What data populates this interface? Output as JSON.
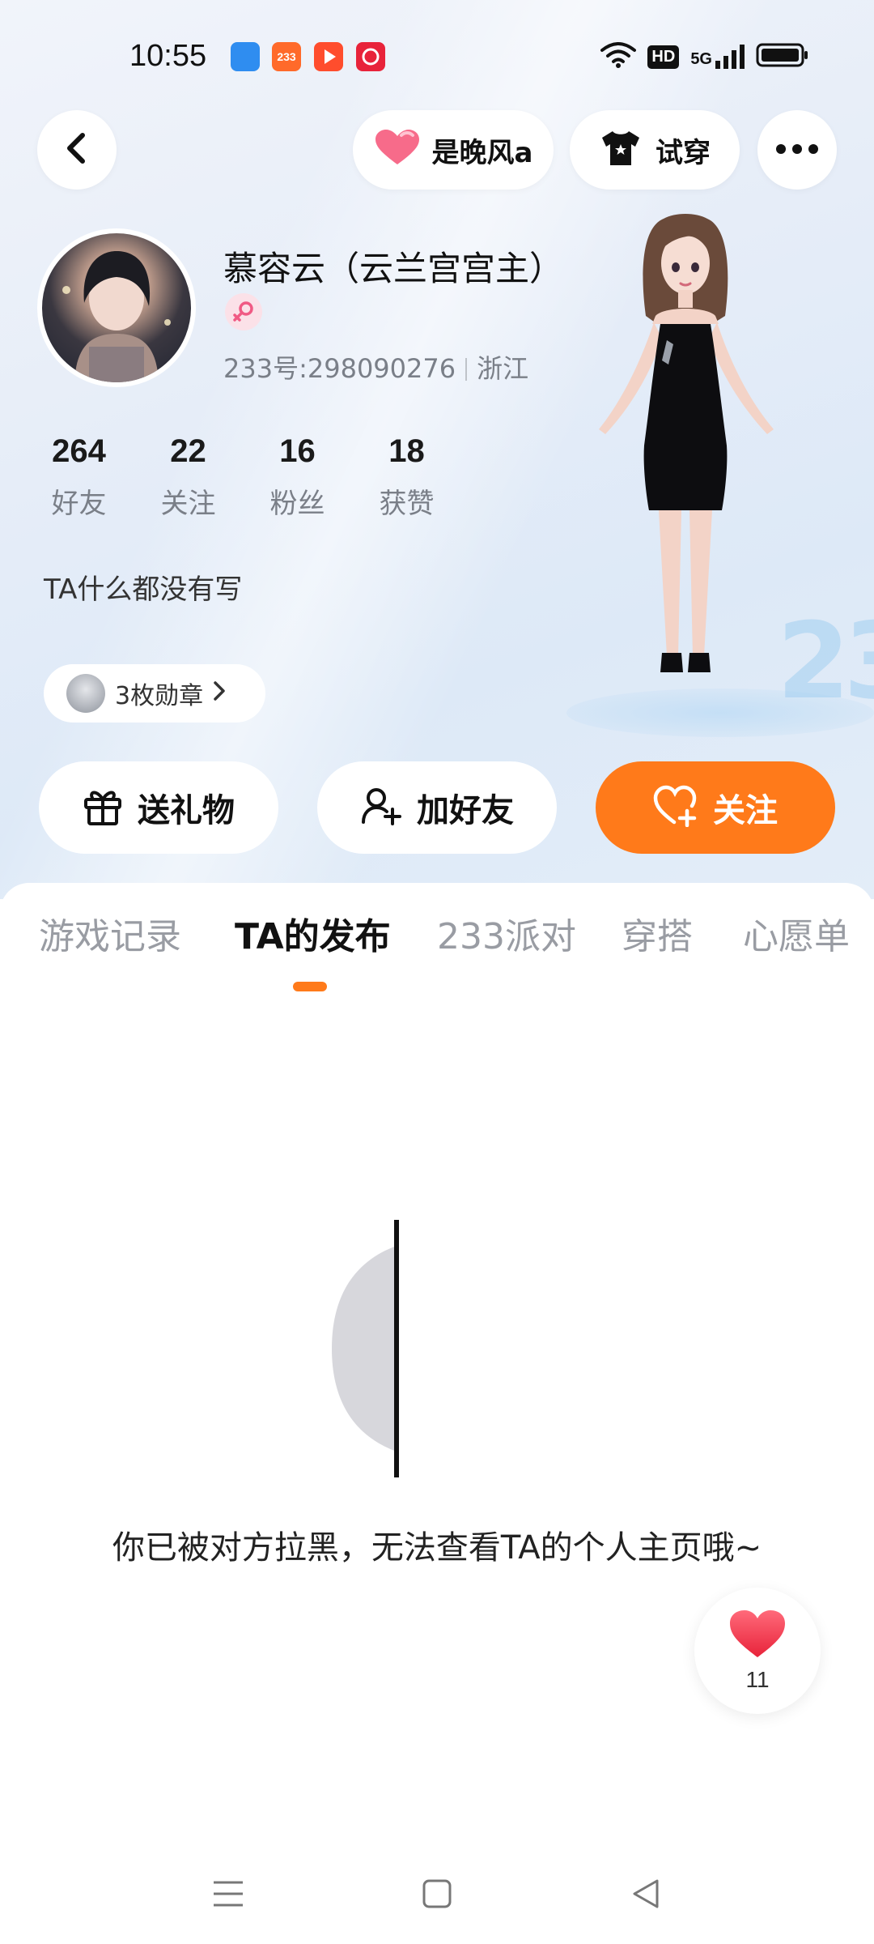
{
  "status_bar": {
    "time": "10:55",
    "notification_icons": [
      {
        "name": "app-icon-blue",
        "color": "#2f8df0"
      },
      {
        "name": "app-icon-233",
        "color": "#ff6a2a",
        "label": "233"
      },
      {
        "name": "video-icon",
        "color": "#ff4d2d"
      },
      {
        "name": "app-icon-red",
        "color": "#e8233a"
      }
    ],
    "hd": "HD",
    "network": "5G"
  },
  "header": {
    "back_icon": "chevron-left-icon",
    "user_chip_label": "是晚风a",
    "tryon_label": "试穿",
    "more_icon": "more-icon"
  },
  "profile": {
    "nickname": "慕容云（云兰宫宫主）",
    "gender_icon": "female-icon",
    "uid": "233号:298090276",
    "location": "浙江",
    "stats": [
      {
        "value": "264",
        "label": "好友"
      },
      {
        "value": "22",
        "label": "关注"
      },
      {
        "value": "16",
        "label": "粉丝"
      },
      {
        "value": "18",
        "label": "获赞"
      }
    ],
    "bio": "TA什么都没有写",
    "medals": "3枚勋章"
  },
  "actions": {
    "gift": "送礼物",
    "add_friend": "加好友",
    "follow": "关注"
  },
  "tabs": [
    {
      "label": "游戏记录",
      "active": false
    },
    {
      "label": "TA的发布",
      "active": true
    },
    {
      "label": "233派对",
      "active": false
    },
    {
      "label": "穿搭",
      "active": false
    },
    {
      "label": "心愿单",
      "active": false
    }
  ],
  "empty_state": {
    "message": "你已被对方拉黑，无法查看TA的个人主页哦~"
  },
  "fab": {
    "icon": "heart-icon",
    "count": "11"
  },
  "colors": {
    "accent": "#ff7a1a",
    "hero_bg": "#e6edf8"
  }
}
